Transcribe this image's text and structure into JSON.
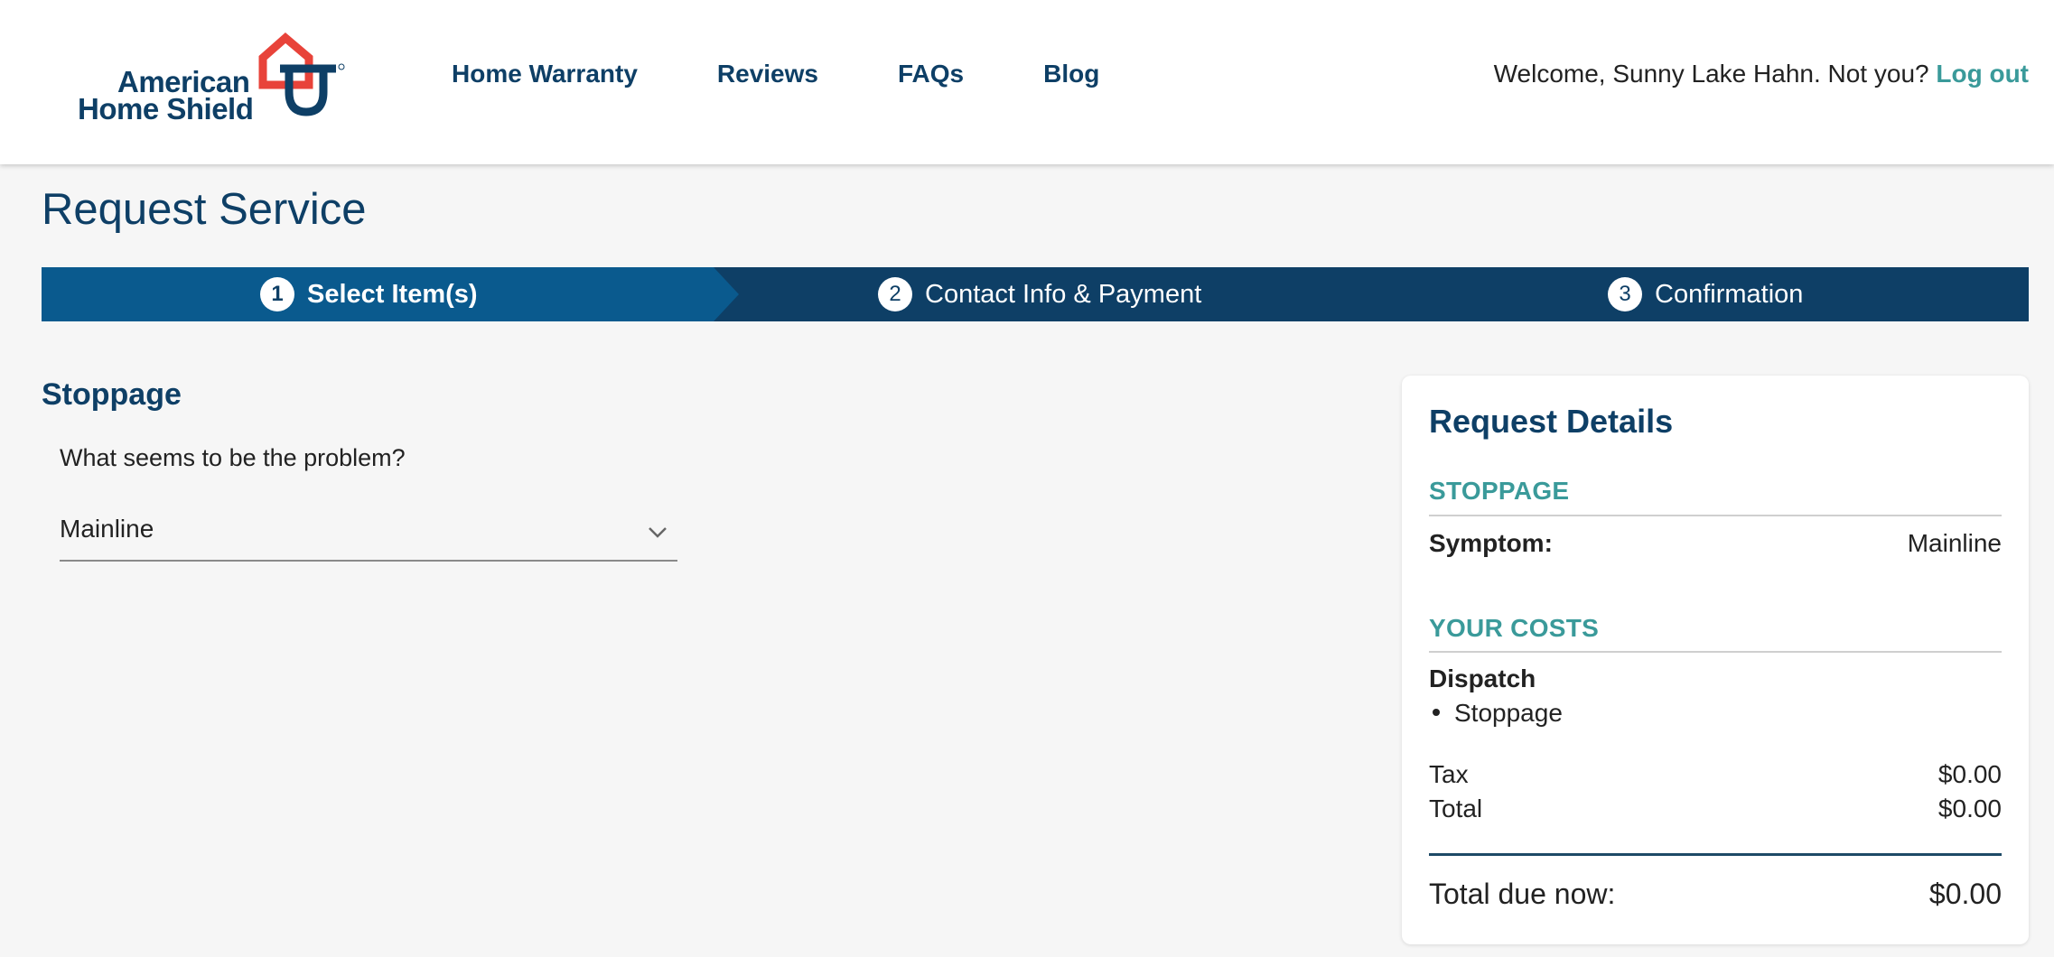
{
  "brand": {
    "line1": "American",
    "line2": "Home Shield",
    "colors": {
      "navy": "#0e3f66",
      "red": "#e8433a",
      "teal": "#3a9a9a"
    }
  },
  "nav": {
    "items": [
      {
        "label": "Home Warranty"
      },
      {
        "label": "Reviews"
      },
      {
        "label": "FAQs"
      },
      {
        "label": "Blog"
      }
    ]
  },
  "user": {
    "welcome": "Welcome, Sunny Lake Hahn. Not you?",
    "logout_label": "Log out"
  },
  "page": {
    "title": "Request Service"
  },
  "stepper": {
    "steps": [
      {
        "number": "1",
        "label": "Select Item(s)",
        "active": true
      },
      {
        "number": "2",
        "label": "Contact Info & Payment",
        "active": false
      },
      {
        "number": "3",
        "label": "Confirmation",
        "active": false
      }
    ]
  },
  "form": {
    "section_title": "Stoppage",
    "question": "What seems to be the problem?",
    "selected_value": "Mainline"
  },
  "details": {
    "title": "Request Details",
    "item_heading": "STOPPAGE",
    "symptom_label": "Symptom:",
    "symptom_value": "Mainline",
    "costs_heading": "YOUR COSTS",
    "dispatch_label": "Dispatch",
    "dispatch_items": [
      "Stoppage"
    ],
    "tax_label": "Tax",
    "tax_value": "$0.00",
    "total_label": "Total",
    "total_value": "$0.00",
    "due_label": "Total due now:",
    "due_value": "$0.00"
  }
}
